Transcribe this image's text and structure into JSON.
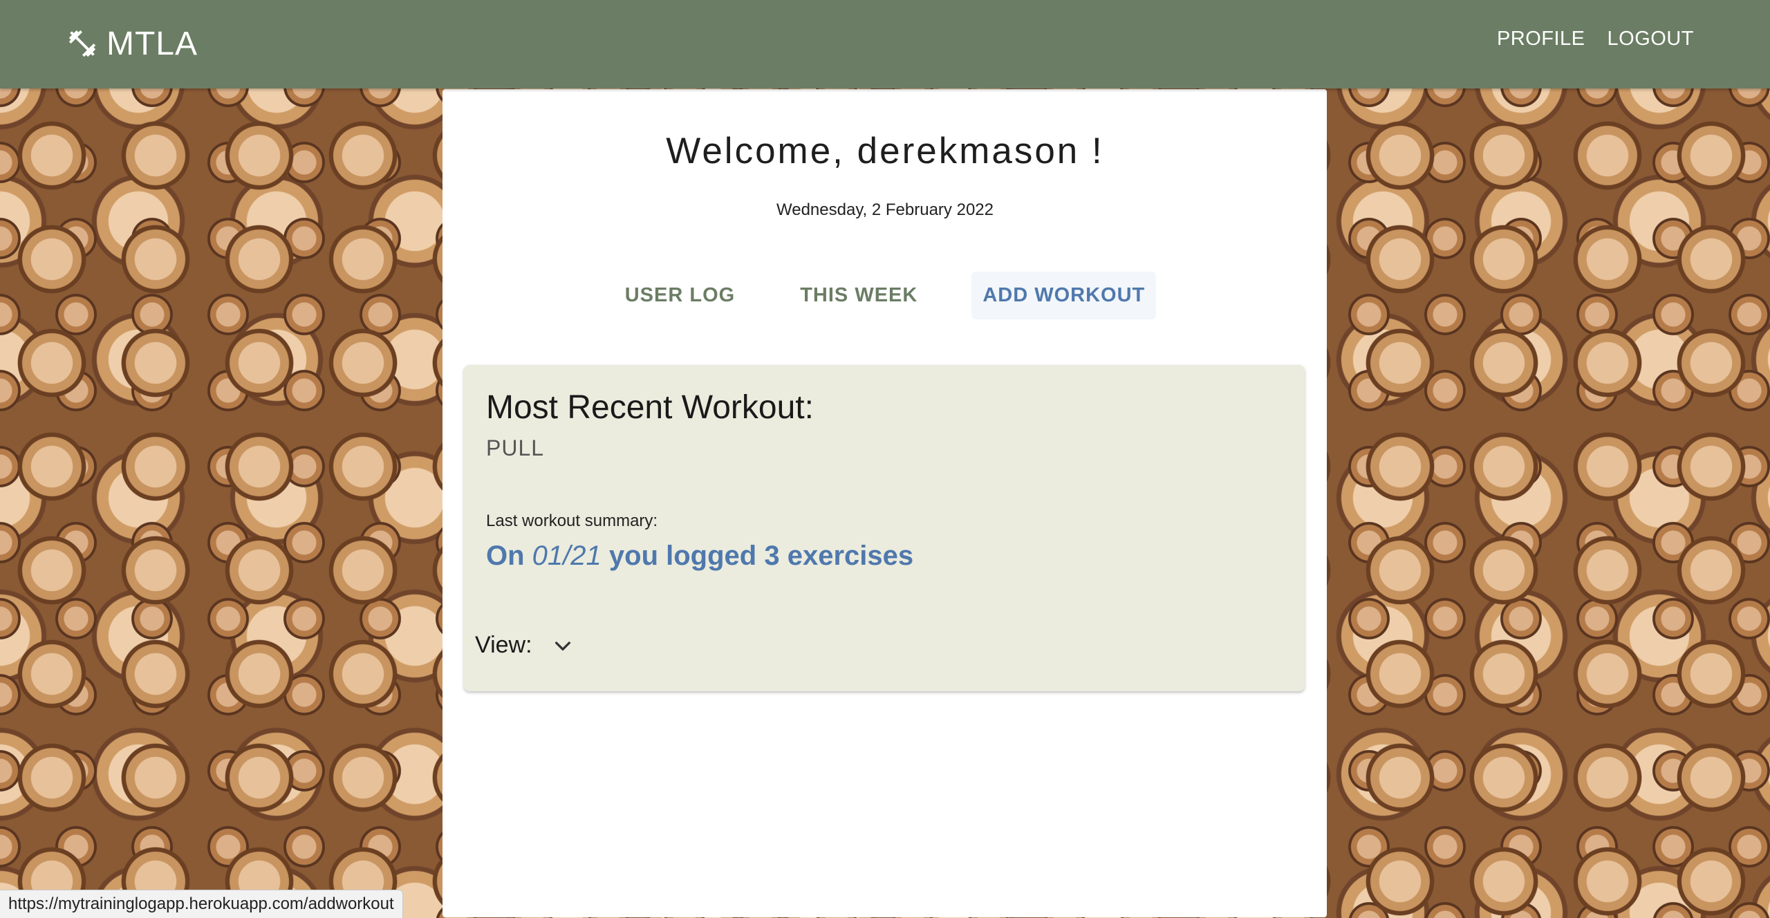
{
  "navbar": {
    "brand": "MTLA",
    "brand_icon": "dumbbell-icon",
    "links": [
      "PROFILE",
      "LOGOUT"
    ]
  },
  "main": {
    "welcome": "Welcome, derekmason !",
    "date": "Wednesday, 2 February 2022",
    "tabs": [
      {
        "label": "USER LOG",
        "active": false
      },
      {
        "label": "THIS WEEK",
        "active": false
      },
      {
        "label": "ADD WORKOUT",
        "active": true
      }
    ]
  },
  "card": {
    "title": "Most Recent Workout:",
    "workout_type": "PULL",
    "summary_label": "Last workout summary:",
    "summary_prefix": "On",
    "summary_date": "01/21",
    "summary_suffix": "you logged 3 exercises",
    "view_label": "View:"
  },
  "status_bar": {
    "url": "https://mytraininglogapp.herokuapp.com/addworkout"
  },
  "colors": {
    "navbar": "#6b7d64",
    "accent": "#4f78ad",
    "card_bg": "#ebecde"
  }
}
